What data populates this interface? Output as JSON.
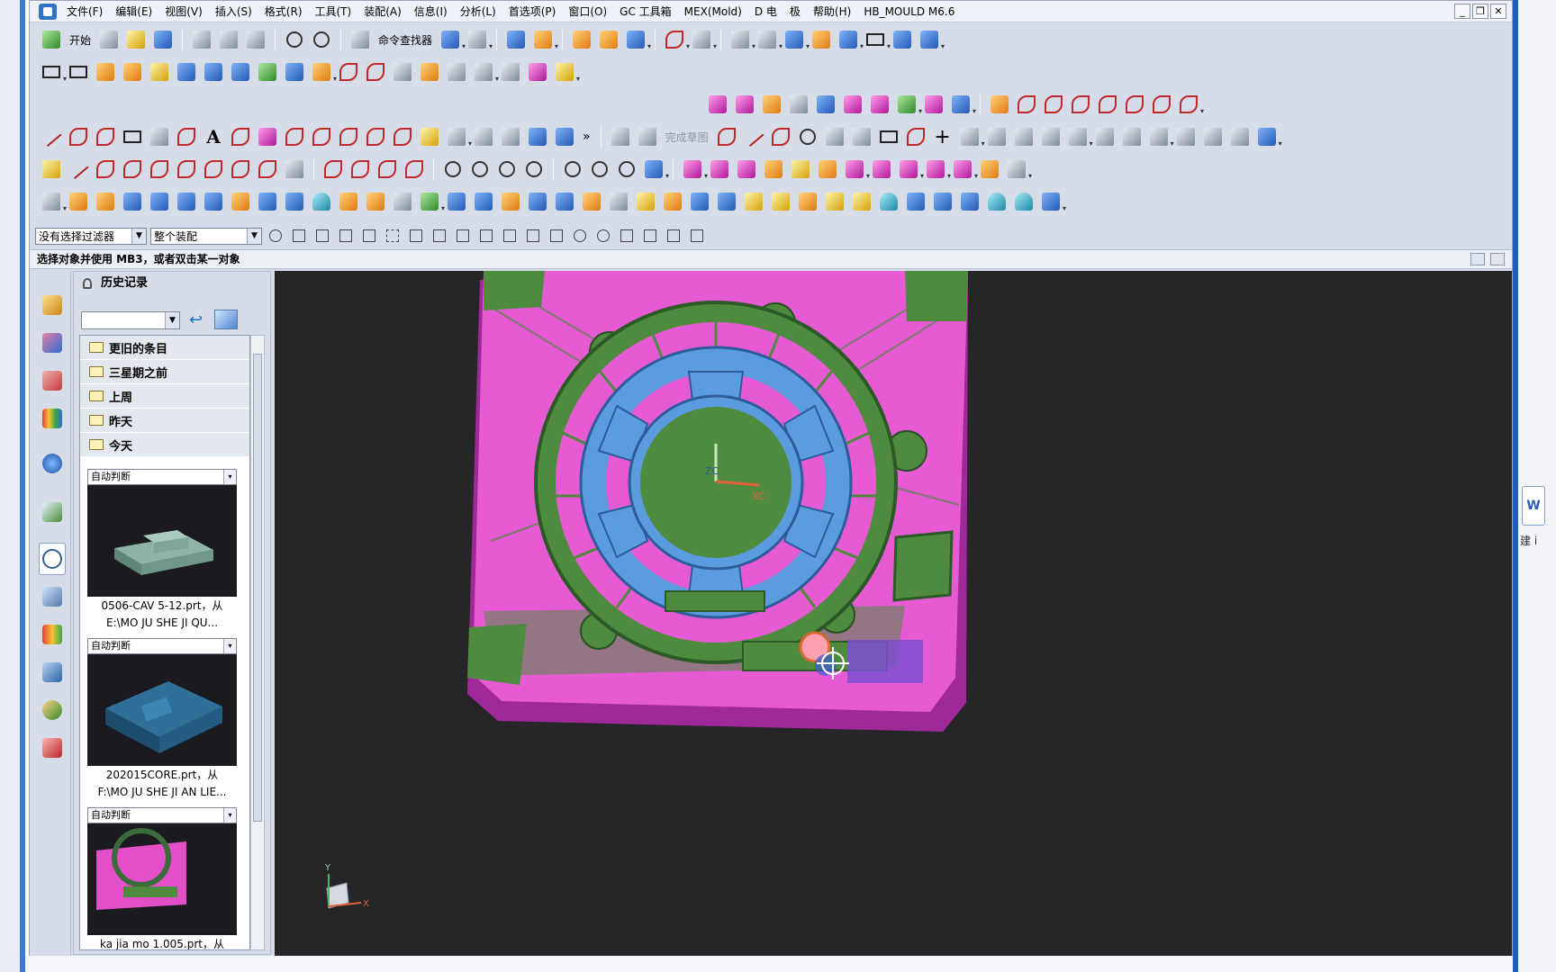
{
  "app": {
    "menus": [
      "文件(F)",
      "编辑(E)",
      "视图(V)",
      "插入(S)",
      "格式(R)",
      "工具(T)",
      "装配(A)",
      "信息(I)",
      "分析(L)",
      "首选项(P)",
      "窗口(O)",
      "GC 工具箱",
      "MEX(Mold)",
      "D 电",
      "极",
      "帮助(H)",
      "HB_MOULD M6.6"
    ],
    "window_buttons": [
      "_",
      "❐",
      "✕"
    ]
  },
  "toolbar": {
    "start_label": "开始",
    "command_finder_label": "命令查找器",
    "finish_sketch_label": "完成草图",
    "text_tool_label": "A"
  },
  "filter": {
    "type_filter": "没有选择过滤器",
    "scope_filter": "整个装配"
  },
  "status": {
    "prompt": "选择对象并使用 MB3，或者双击某一对象"
  },
  "history": {
    "title": "历史记录",
    "folders": [
      "更旧的条目",
      "三星期之前",
      "上周",
      "昨天",
      "今天"
    ],
    "cards": [
      {
        "mode": "自动判断",
        "line1": "0506-CAV 5-12.prt，从",
        "line2": "E:\\MO JU SHE JI QU..."
      },
      {
        "mode": "自动判断",
        "line1": "202015CORE.prt，从",
        "line2": "F:\\MO JU SHE JI AN LIE..."
      },
      {
        "mode": "自动判断",
        "line1": "ka jia mo 1.005.prt，从",
        "line2": ""
      }
    ]
  },
  "viewport": {
    "axis_labels": {
      "zc": "ZC",
      "xc": "XC",
      "y": "Y",
      "x": "X"
    },
    "colors": {
      "background": "#262628",
      "magenta": "#e65bd4",
      "green": "#4e8b3f",
      "blue": "#5b9be0"
    }
  },
  "right_edge": {
    "letter": "W",
    "text": "建 i"
  }
}
